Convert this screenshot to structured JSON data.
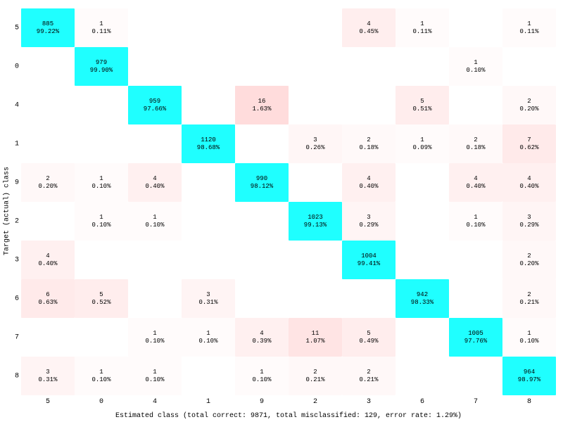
{
  "chart_data": {
    "type": "heatmap",
    "ylabel": "Target (actual) class",
    "xlabel": "Estimated class (total correct: 9871, total misclassified: 129, error rate: 1.29%)",
    "y_categories": [
      "5",
      "0",
      "4",
      "1",
      "9",
      "2",
      "3",
      "6",
      "7",
      "8"
    ],
    "x_categories": [
      "5",
      "0",
      "4",
      "1",
      "9",
      "2",
      "3",
      "6",
      "7",
      "8"
    ],
    "cells": [
      [
        {
          "count": 885,
          "pct": "99.22%",
          "bg": "#1fffff"
        },
        {
          "count": 1,
          "pct": "0.11%",
          "bg": "#fffbfb"
        },
        null,
        null,
        null,
        null,
        {
          "count": 4,
          "pct": "0.45%",
          "bg": "#ffeeee"
        },
        {
          "count": 1,
          "pct": "0.11%",
          "bg": "#fffbfb"
        },
        null,
        {
          "count": 1,
          "pct": "0.11%",
          "bg": "#fffbfb"
        }
      ],
      [
        null,
        {
          "count": 979,
          "pct": "99.90%",
          "bg": "#1fffff"
        },
        null,
        null,
        null,
        null,
        null,
        null,
        {
          "count": 1,
          "pct": "0.10%",
          "bg": "#fffbfb"
        },
        null
      ],
      [
        null,
        null,
        {
          "count": 959,
          "pct": "97.66%",
          "bg": "#1fffff"
        },
        null,
        {
          "count": 16,
          "pct": "1.63%",
          "bg": "#ffdcdc"
        },
        null,
        null,
        {
          "count": 5,
          "pct": "0.51%",
          "bg": "#ffeded"
        },
        null,
        {
          "count": 2,
          "pct": "0.20%",
          "bg": "#fff8f8"
        }
      ],
      [
        null,
        null,
        null,
        {
          "count": 1120,
          "pct": "98.68%",
          "bg": "#1fffff"
        },
        null,
        {
          "count": 3,
          "pct": "0.26%",
          "bg": "#fff6f6"
        },
        {
          "count": 2,
          "pct": "0.18%",
          "bg": "#fff9f9"
        },
        {
          "count": 1,
          "pct": "0.09%",
          "bg": "#fffbfb"
        },
        {
          "count": 2,
          "pct": "0.18%",
          "bg": "#fff9f9"
        },
        {
          "count": 7,
          "pct": "0.62%",
          "bg": "#ffeaea"
        }
      ],
      [
        {
          "count": 2,
          "pct": "0.20%",
          "bg": "#fff8f8"
        },
        {
          "count": 1,
          "pct": "0.10%",
          "bg": "#fffbfb"
        },
        {
          "count": 4,
          "pct": "0.40%",
          "bg": "#fff0f0"
        },
        null,
        {
          "count": 990,
          "pct": "98.12%",
          "bg": "#1fffff"
        },
        null,
        {
          "count": 4,
          "pct": "0.40%",
          "bg": "#fff0f0"
        },
        null,
        {
          "count": 4,
          "pct": "0.40%",
          "bg": "#fff0f0"
        },
        {
          "count": 4,
          "pct": "0.40%",
          "bg": "#fff0f0"
        }
      ],
      [
        null,
        {
          "count": 1,
          "pct": "0.10%",
          "bg": "#fffbfb"
        },
        {
          "count": 1,
          "pct": "0.10%",
          "bg": "#fffbfb"
        },
        null,
        null,
        {
          "count": 1023,
          "pct": "99.13%",
          "bg": "#1fffff"
        },
        {
          "count": 3,
          "pct": "0.29%",
          "bg": "#fff5f5"
        },
        null,
        {
          "count": 1,
          "pct": "0.10%",
          "bg": "#fffbfb"
        },
        {
          "count": 3,
          "pct": "0.29%",
          "bg": "#fff5f5"
        }
      ],
      [
        {
          "count": 4,
          "pct": "0.40%",
          "bg": "#fff0f0"
        },
        null,
        null,
        null,
        null,
        null,
        {
          "count": 1004,
          "pct": "99.41%",
          "bg": "#1fffff"
        },
        null,
        null,
        {
          "count": 2,
          "pct": "0.20%",
          "bg": "#fff8f8"
        }
      ],
      [
        {
          "count": 6,
          "pct": "0.63%",
          "bg": "#ffeaea"
        },
        {
          "count": 5,
          "pct": "0.52%",
          "bg": "#ffeded"
        },
        null,
        {
          "count": 3,
          "pct": "0.31%",
          "bg": "#fff4f4"
        },
        null,
        null,
        null,
        {
          "count": 942,
          "pct": "98.33%",
          "bg": "#1fffff"
        },
        null,
        {
          "count": 2,
          "pct": "0.21%",
          "bg": "#fff8f8"
        }
      ],
      [
        null,
        null,
        {
          "count": 1,
          "pct": "0.10%",
          "bg": "#fffbfb"
        },
        {
          "count": 1,
          "pct": "0.10%",
          "bg": "#fffbfb"
        },
        {
          "count": 4,
          "pct": "0.39%",
          "bg": "#fff0f0"
        },
        {
          "count": 11,
          "pct": "1.07%",
          "bg": "#ffe4e4"
        },
        {
          "count": 5,
          "pct": "0.49%",
          "bg": "#ffeded"
        },
        null,
        {
          "count": 1005,
          "pct": "97.76%",
          "bg": "#1fffff"
        },
        {
          "count": 1,
          "pct": "0.10%",
          "bg": "#fffbfb"
        }
      ],
      [
        {
          "count": 3,
          "pct": "0.31%",
          "bg": "#fff4f4"
        },
        {
          "count": 1,
          "pct": "0.10%",
          "bg": "#fffbfb"
        },
        {
          "count": 1,
          "pct": "0.10%",
          "bg": "#fffbfb"
        },
        null,
        {
          "count": 1,
          "pct": "0.10%",
          "bg": "#fffbfb"
        },
        {
          "count": 2,
          "pct": "0.21%",
          "bg": "#fff8f8"
        },
        {
          "count": 2,
          "pct": "0.21%",
          "bg": "#fff8f8"
        },
        null,
        null,
        {
          "count": 964,
          "pct": "98.97%",
          "bg": "#1fffff"
        }
      ]
    ]
  }
}
